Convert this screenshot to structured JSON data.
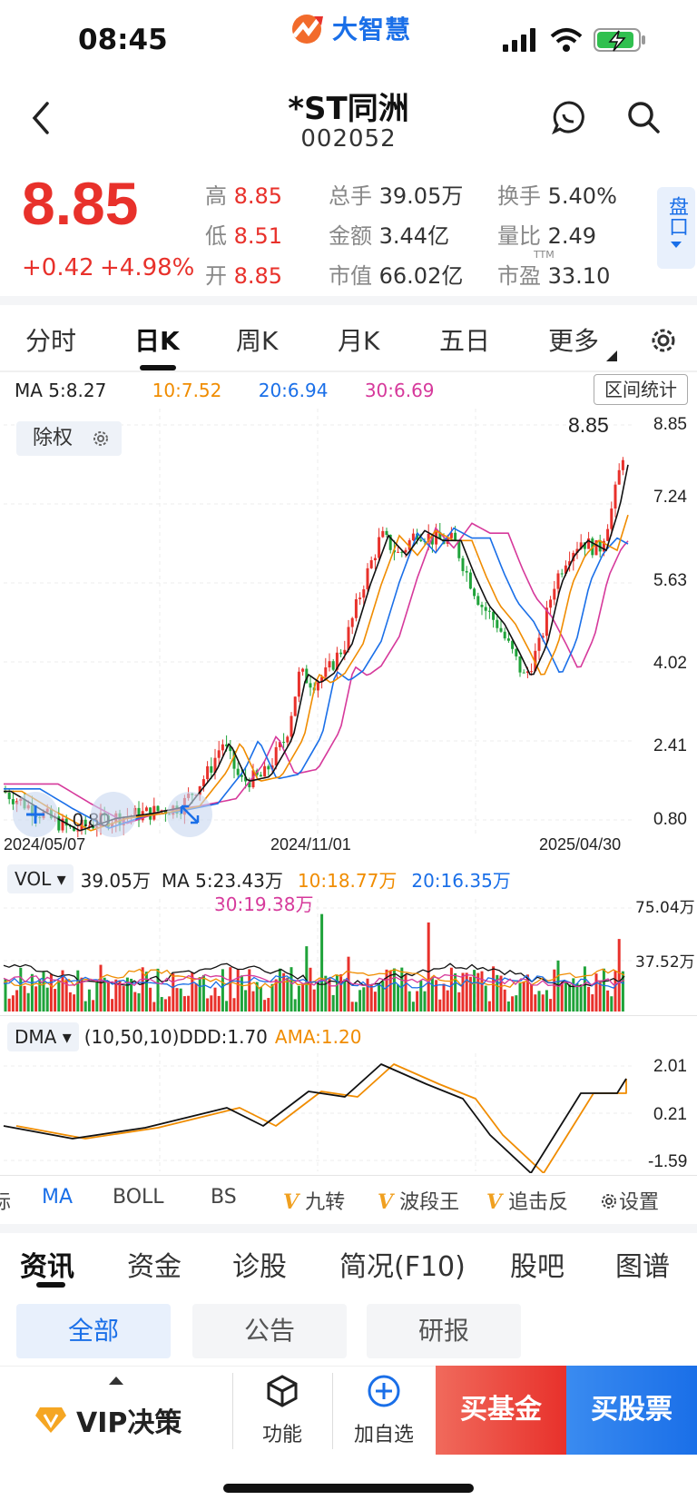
{
  "status": {
    "time": "08:45"
  },
  "app": {
    "logo_text": "大智慧"
  },
  "header": {
    "name": "*ST同洲",
    "code": "002052"
  },
  "quote": {
    "price": "8.85",
    "change": "+0.42",
    "change_pct": "+4.98%",
    "high_label": "高",
    "high": "8.85",
    "low_label": "低",
    "low": "8.51",
    "open_label": "开",
    "open": "8.85",
    "volume_label": "总手",
    "volume": "39.05万",
    "amount_label": "金额",
    "amount": "3.44亿",
    "mktcap_label": "市值",
    "mktcap": "66.02亿",
    "turnover_label": "换手",
    "turnover": "5.40%",
    "volratio_label": "量比",
    "volratio": "2.49",
    "pe_label": "市盈",
    "pe_tag": "TTM",
    "pe": "33.10",
    "pankou": "盘口"
  },
  "period_tabs": [
    "分时",
    "日K",
    "周K",
    "月K",
    "五日",
    "更多"
  ],
  "active_period": 1,
  "ma_legend": {
    "ma5": "MA 5:8.27",
    "ma10": "10:7.52",
    "ma20": "20:6.94",
    "ma30": "30:6.69"
  },
  "range_stats_label": "区间统计",
  "chuquan_label": "除权",
  "price_axis": [
    "8.85",
    "7.24",
    "5.63",
    "4.02",
    "2.41",
    "0.80"
  ],
  "last_price_label": "8.85",
  "low_marker_label": "0.80",
  "dates": [
    "2024/05/07",
    "2024/11/01",
    "2025/04/30"
  ],
  "vol_legend": {
    "selector": "VOL",
    "vol": "39.05万",
    "ma5": "MA 5:23.43万",
    "ma10": "10:18.77万",
    "ma20": "20:16.35万",
    "ma30": "30:19.38万"
  },
  "vol_axis": [
    "75.04万",
    "37.52万"
  ],
  "dma_legend": {
    "selector": "DMA",
    "params": "(10,50,10)DDD:1.70",
    "ama": "AMA:1.20"
  },
  "dma_axis": [
    "2.01",
    "0.21",
    "-1.59"
  ],
  "indicator_tabs": [
    "标",
    "MA",
    "BOLL",
    "BS",
    "九转",
    "波段王",
    "追击反",
    "设置"
  ],
  "news_tabs": [
    "资讯",
    "资金",
    "诊股",
    "简况(F10)",
    "股吧",
    "图谱"
  ],
  "filters": [
    "全部",
    "公告",
    "研报"
  ],
  "bottom": {
    "vip": "VIP决策",
    "func": "功能",
    "add": "加自选",
    "buy_fund": "买基金",
    "buy_stock": "买股票"
  },
  "colors": {
    "red": "#e8312b",
    "green": "#1fa33a",
    "blue": "#1a6fe8",
    "orange": "#f08c00",
    "magenta": "#d6399b"
  }
}
